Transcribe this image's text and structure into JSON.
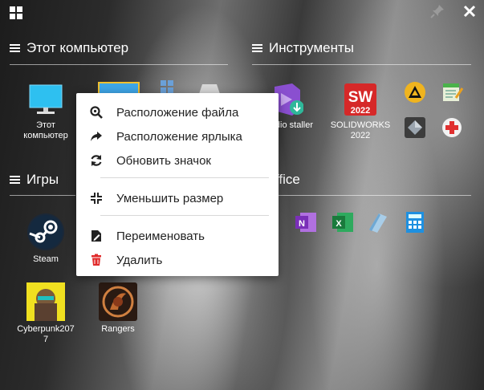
{
  "groups": {
    "computer": {
      "title": "Этот компьютер"
    },
    "tools": {
      "title": "Инструменты"
    },
    "games": {
      "title": "Игры"
    },
    "office": {
      "title": "ffice"
    }
  },
  "tiles": {
    "this_pc": {
      "label": "Этот компьютер"
    },
    "vs_installer": {
      "label": "al Studio staller"
    },
    "solidworks": {
      "label": "SOLIDWORKS 2022"
    },
    "solidworks_year": {
      "text": "2022"
    },
    "steam": {
      "label": "Steam"
    },
    "cyberpunk": {
      "label": "Cyberpunk2077"
    },
    "rangers": {
      "label": "Rangers"
    }
  },
  "context_menu": {
    "items": [
      {
        "label": "Расположение файла",
        "icon": "search-icon"
      },
      {
        "label": "Расположение ярлыка",
        "icon": "share-arrow-icon"
      },
      {
        "label": "Обновить значок",
        "icon": "refresh-icon"
      },
      {
        "label": "Уменьшить размер",
        "icon": "compress-icon"
      },
      {
        "label": "Переименовать",
        "icon": "rename-file-icon"
      },
      {
        "label": "Удалить",
        "icon": "trash-icon",
        "color": "#e02a2a"
      }
    ]
  },
  "colors": {
    "accent_red": "#e02a2a",
    "menu_bg": "#ffffff"
  }
}
